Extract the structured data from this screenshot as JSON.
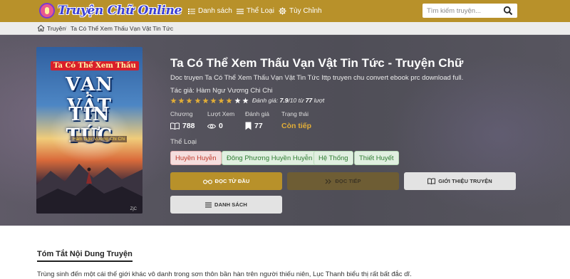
{
  "header": {
    "logo_text": "Truyện Chữ Online",
    "nav": [
      {
        "label": "Danh sách",
        "icon": "list-icon"
      },
      {
        "label": "Thể Loại",
        "icon": "menu-icon"
      },
      {
        "label": "Tùy Chỉnh",
        "icon": "gear-icon"
      }
    ],
    "search": {
      "placeholder": "Tìm kiếm truyện...",
      "value": "",
      "icon": "search-icon"
    }
  },
  "breadcrumb": {
    "items": [
      "Truyện",
      "Ta Có Thể Xem Thấu Vạn Vật Tin Tức"
    ],
    "separator": "/"
  },
  "book": {
    "cover": {
      "line1": "Ta Có Thể Xem Thấu",
      "line2": "VẠN VẬT",
      "line3": "TIN TỨC",
      "author_tag": "Hàm Ngư Vương Chi Chi",
      "mark": "ZjC"
    },
    "title": "Ta Có Thể Xem Thấu Vạn Vật Tin Tức - Truyện Chữ",
    "description": "Doc truyen Ta Có Thể Xem Thấu Vạn Vật Tin Tức Ittp truyen chu convert ebook prc download full.",
    "author_label": "Tác giả:",
    "author": "Hàm Ngư Vương Chi Chi",
    "rating": {
      "stars_total": 10,
      "stars_filled": 8,
      "prefix": "Đánh giá:",
      "score": "7.9",
      "scale": "/10 từ",
      "votes": "77",
      "suffix": "lượt"
    },
    "stats": [
      {
        "label": "Chương",
        "value": "788",
        "icon": "book-icon"
      },
      {
        "label": "Lượt Xem",
        "value": "0",
        "icon": "eye-icon"
      },
      {
        "label": "Đánh giá",
        "value": "77",
        "icon": "bookmark-icon"
      },
      {
        "label": "Trạng thái",
        "value": "Còn tiếp"
      }
    ],
    "genre_label": "Thể Loại",
    "genres": [
      "Huyền Huyễn",
      "Đông Phương Huyền Huyễn",
      "Hệ Thống",
      "Thiết Huyết"
    ]
  },
  "actions": {
    "read_from_start": {
      "label": "ĐỌC TỪ ĐẦU",
      "icon": "glasses-icon"
    },
    "read_next": {
      "label": "ĐỌC TIẾP",
      "icon": "double-chevron-right-icon"
    },
    "intro": {
      "label": "GIỚI THIỆU TRUYỆN",
      "icon": "open-book-icon"
    },
    "chapter_list": {
      "label": "DANH SÁCH",
      "icon": "list-icon"
    }
  },
  "summary": {
    "heading": "Tóm Tắt Nội Dung Truyện",
    "text": "Trùng sinh đến một cái thế giới khác vô danh trong sơn thôn bần hàn trên người thiếu niên, Lục Thanh biểu thị rất bất đắc dĩ."
  },
  "colors": {
    "brand": "#b8912a",
    "status": "#e2ae37",
    "star": "#e2ae37",
    "star_empty": "#ffffff"
  }
}
